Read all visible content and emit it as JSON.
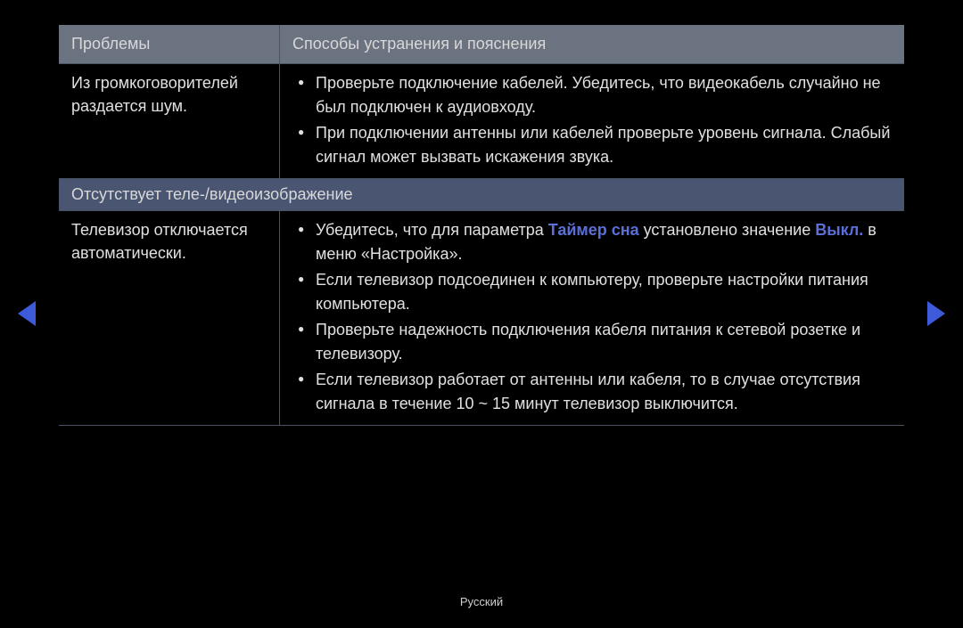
{
  "headers": {
    "left": "Проблемы",
    "right": "Способы устранения и пояснения"
  },
  "rows": [
    {
      "problem": "Из громкоговорителей раздается шум.",
      "solutions": [
        {
          "text": "Проверьте подключение кабелей. Убедитесь, что видеокабель случайно не был подключен к аудиовходу."
        },
        {
          "text": "При подключении антенны или кабелей проверьте уровень сигнала. Слабый сигнал может вызвать искажения звука."
        }
      ]
    }
  ],
  "section_title": "Отсутствует теле-/видеоизображение",
  "rows2": [
    {
      "problem": "Телевизор отключается автоматически.",
      "solutions": [
        {
          "pre": "Убедитесь, что для параметра ",
          "hl1": "Таймер сна",
          "mid": " установлено значение ",
          "hl2": "Выкл.",
          "post": " в меню «Настройка»."
        },
        {
          "text": "Если телевизор подсоединен к компьютеру, проверьте настройки питания компьютера."
        },
        {
          "text": "Проверьте надежность подключения кабеля питания к сетевой розетке и телевизору."
        },
        {
          "text": "Если телевизор работает от антенны или кабеля, то в случае отсутствия сигнала в течение 10 ~ 15 минут телевизор выключится."
        }
      ]
    }
  ],
  "footer": {
    "lang": "Русский"
  }
}
